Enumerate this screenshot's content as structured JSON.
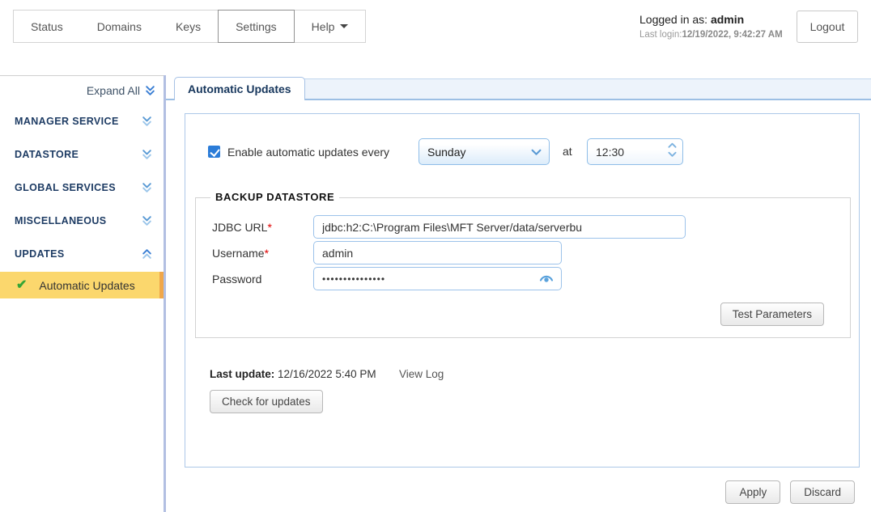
{
  "header": {
    "nav": [
      {
        "label": "Status"
      },
      {
        "label": "Domains"
      },
      {
        "label": "Keys"
      },
      {
        "label": "Settings",
        "selected": true
      },
      {
        "label": "Help"
      }
    ],
    "logged_in_label": "Logged in as:",
    "logged_in_user": "admin",
    "last_login_label": "Last login:",
    "last_login_value": "12/19/2022, 9:42:27 AM",
    "logout_label": "Logout"
  },
  "sidebar": {
    "expand_all_label": "Expand All",
    "sections": [
      {
        "label": "MANAGER SERVICE",
        "state": "collapsed"
      },
      {
        "label": "DATASTORE",
        "state": "collapsed"
      },
      {
        "label": "GLOBAL SERVICES",
        "state": "collapsed"
      },
      {
        "label": "MISCELLANEOUS",
        "state": "collapsed"
      },
      {
        "label": "UPDATES",
        "state": "expanded"
      }
    ],
    "active_item": {
      "label": "Automatic Updates",
      "icon": "check-icon"
    }
  },
  "main": {
    "tab_label": "Automatic Updates",
    "schedule": {
      "checkbox_checked": true,
      "checkbox_label": "Enable automatic updates every",
      "day_value": "Sunday",
      "at_label": "at",
      "time_value": "12:30"
    },
    "backup_datastore": {
      "legend": "BACKUP DATASTORE",
      "required_marker": "*",
      "fields": [
        {
          "label": "JDBC URL",
          "required": true,
          "value": "jdbc:h2:C:\\Program Files\\MFT Server/data/serverbu"
        },
        {
          "label": "Username",
          "required": true,
          "value": "admin"
        },
        {
          "label": "Password",
          "required": false,
          "value": "•••••••••••••••",
          "masked": true
        }
      ],
      "test_button_label": "Test Parameters"
    },
    "updates_status": {
      "last_update_label": "Last update:",
      "last_update_value": "12/16/2022 5:40 PM",
      "view_log_label": "View Log",
      "check_button_label": "Check for updates"
    },
    "footer": {
      "apply_label": "Apply",
      "discard_label": "Discard"
    }
  },
  "icons": {
    "check_glyph": "✔"
  },
  "colors": {
    "highlight_yellow": "#fbd76d",
    "highlight_stripe_orange": "#f0a74a",
    "navy_text": "#1e3c64",
    "accent_blue": "#4a90d9",
    "divider_periwinkle": "#b2bfe2",
    "tab_border_blue": "#a6c1e5",
    "input_border_blue": "#9cc2ea",
    "checkbox_blue": "#2b7cd8",
    "check_green": "#35a535",
    "required_red": "#e00000"
  }
}
